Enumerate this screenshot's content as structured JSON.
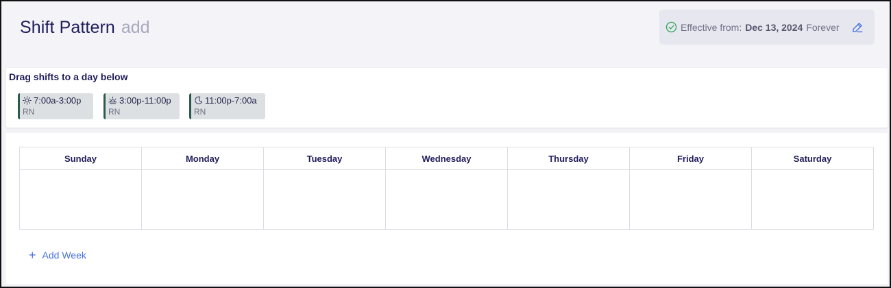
{
  "header": {
    "title": "Shift Pattern",
    "title_suffix": "add",
    "effective": {
      "label": "Effective from:",
      "date": "Dec 13, 2024",
      "until": "Forever"
    }
  },
  "shifts": {
    "heading": "Drag shifts to a day below",
    "items": [
      {
        "time": "7:00a-3:00p",
        "role": "RN",
        "icon": "sun-icon"
      },
      {
        "time": "3:00p-11:00p",
        "role": "RN",
        "icon": "sunset-icon"
      },
      {
        "time": "11:00p-7:00a",
        "role": "RN",
        "icon": "moon-icon"
      }
    ]
  },
  "week": {
    "days": [
      "Sunday",
      "Monday",
      "Tuesday",
      "Wednesday",
      "Thursday",
      "Friday",
      "Saturday"
    ]
  },
  "actions": {
    "add_week": "Add Week"
  },
  "colors": {
    "accent": "#4a72e0",
    "title": "#1f1d5a",
    "chip_border": "#2d5b4a",
    "check": "#3aa65c"
  }
}
